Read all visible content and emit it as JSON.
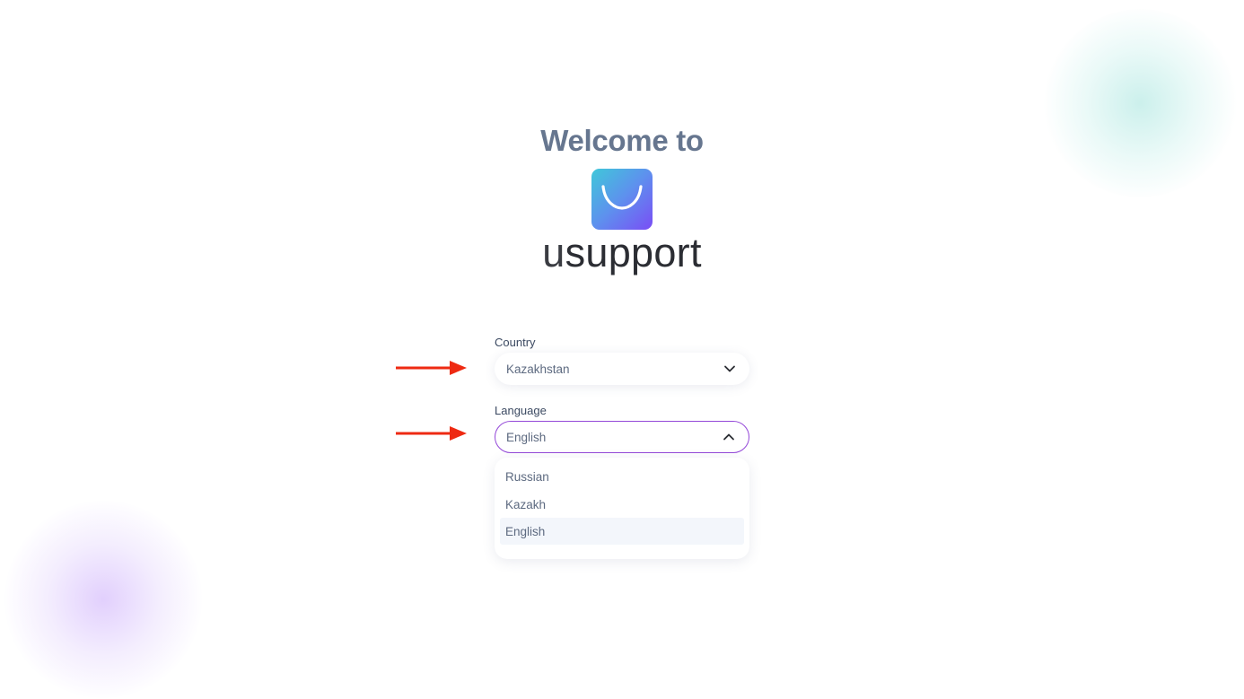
{
  "welcome_text": "Welcome to",
  "brand": {
    "prefix": "u",
    "name": "support",
    "colors": {
      "gradient_start": "#3fc8d9",
      "gradient_end": "#7a4df5"
    }
  },
  "country": {
    "label": "Country",
    "value": "Kazakhstan",
    "icon": "chevron-down-icon"
  },
  "language": {
    "label": "Language",
    "value": "English",
    "icon": "chevron-up-icon",
    "options": [
      "Russian",
      "Kazakh",
      "English"
    ],
    "selected": "English"
  },
  "annotations": {
    "arrow_color": "#ee2a12",
    "icon": "arrow-right-icon"
  },
  "colors": {
    "accent": "#9448d8",
    "text_muted": "#5d6a80",
    "heading": "#66768f"
  }
}
